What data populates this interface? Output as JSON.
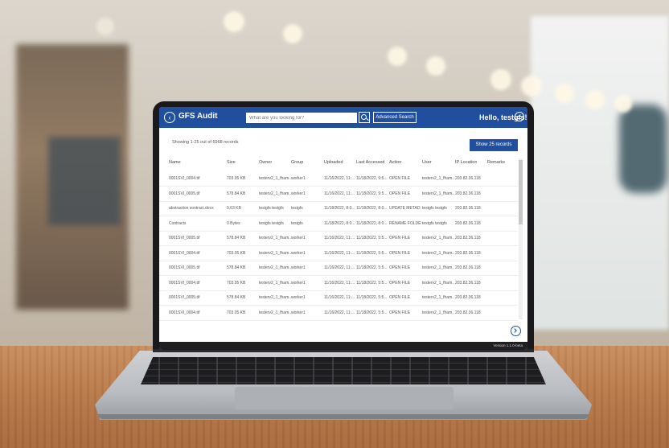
{
  "app": {
    "title": "GFS Audit",
    "search_placeholder": "What are you looking for?",
    "advanced_search_label": "Advanced Search",
    "greeting": "Hello, testgfs!",
    "records_summary": "Showing 1-25 out of 6968 records",
    "show_records_label": "Show 25 records",
    "version": "Version 1.1.0-beta",
    "accent_color": "#1f4f9e"
  },
  "table": {
    "columns": [
      "Name",
      "Size",
      "Owner",
      "Group",
      "Uploaded",
      "Last Accessed",
      "Action",
      "User",
      "IP Location",
      "Remarks"
    ],
    "rows": [
      {
        "name": "0001SVI_0004.tif",
        "size": "703.05 KB",
        "owner": "testerv2_1_fham...",
        "group": "worker1",
        "uploaded": "11/16/2022, 11:...",
        "accessed": "11/18/2022, 9:5...",
        "action": "OPEN FILE",
        "user": "testerv2_1_fham...",
        "ip": "203.82.36.118",
        "remarks": ""
      },
      {
        "name": "0001SVI_0005.tif",
        "size": "578.84 KB",
        "owner": "testerv2_1_fham...",
        "group": "worker1",
        "uploaded": "11/16/2022, 11:...",
        "accessed": "11/18/2022, 9:5...",
        "action": "OPEN FILE",
        "user": "testerv2_1_fham...",
        "ip": "203.82.36.118",
        "remarks": ""
      },
      {
        "name": "abstraction contract.docx",
        "size": "9.63 KB",
        "owner": "testgfs testgfs",
        "group": "testgfs",
        "uploaded": "11/18/2022, 8:0...",
        "accessed": "11/18/2022, 8:0...",
        "action": "UPDATE METAD...",
        "user": "testgfs testgfs",
        "ip": "203.82.36.118",
        "remarks": ""
      },
      {
        "name": "Contracts",
        "size": "0 Bytes",
        "owner": "testgfs testgfs",
        "group": "testgfs",
        "uploaded": "11/18/2022, 8:0...",
        "accessed": "11/18/2022, 8:0...",
        "action": "RENAME FOLDER",
        "user": "testgfs testgfs",
        "ip": "203.82.36.118",
        "remarks": ""
      },
      {
        "name": "0001SVI_0005.tif",
        "size": "578.84 KB",
        "owner": "testerv2_1_fham...",
        "group": "worker1",
        "uploaded": "11/16/2022, 11:...",
        "accessed": "11/18/2022, 5:5...",
        "action": "OPEN FILE",
        "user": "testerv2_1_fham...",
        "ip": "203.82.36.118",
        "remarks": ""
      },
      {
        "name": "0001SVI_0004.tif",
        "size": "703.05 KB",
        "owner": "testerv2_1_fham...",
        "group": "worker1",
        "uploaded": "11/16/2022, 11:...",
        "accessed": "11/18/2022, 5:5...",
        "action": "OPEN FILE",
        "user": "testerv2_1_fham...",
        "ip": "203.82.36.118",
        "remarks": ""
      },
      {
        "name": "0001SVI_0005.tif",
        "size": "578.84 KB",
        "owner": "testerv2_1_fham...",
        "group": "worker1",
        "uploaded": "11/16/2022, 11:...",
        "accessed": "11/18/2022, 5:5...",
        "action": "OPEN FILE",
        "user": "testerv2_1_fham...",
        "ip": "203.82.36.118",
        "remarks": ""
      },
      {
        "name": "0001SVI_0004.tif",
        "size": "703.05 KB",
        "owner": "testerv2_1_fham...",
        "group": "worker1",
        "uploaded": "11/16/2022, 11:...",
        "accessed": "11/18/2022, 5:5...",
        "action": "OPEN FILE",
        "user": "testerv2_1_fham...",
        "ip": "203.82.36.118",
        "remarks": ""
      },
      {
        "name": "0001SVI_0005.tif",
        "size": "578.84 KB",
        "owner": "testerv2_1_fham...",
        "group": "worker1",
        "uploaded": "11/16/2022, 11:...",
        "accessed": "11/18/2022, 5:5...",
        "action": "OPEN FILE",
        "user": "testerv2_1_fham...",
        "ip": "203.82.36.118",
        "remarks": ""
      },
      {
        "name": "0001SVI_0004.tif",
        "size": "703.05 KB",
        "owner": "testerv2_1_fham...",
        "group": "worker1",
        "uploaded": "11/16/2022, 11:...",
        "accessed": "11/18/2022, 5:5...",
        "action": "OPEN FILE",
        "user": "testerv2_1_fham...",
        "ip": "203.82.36.118",
        "remarks": ""
      }
    ]
  }
}
